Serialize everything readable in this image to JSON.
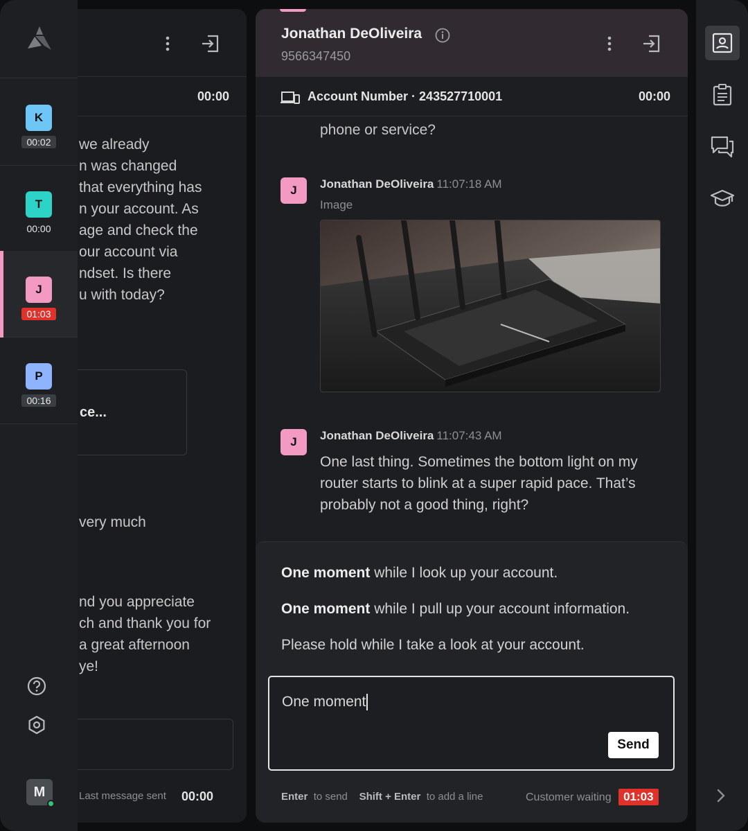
{
  "rail": {
    "conversations": [
      {
        "initial": "K",
        "time": "00:02",
        "color": "#6dc6f5",
        "time_bg": "#3a3d42",
        "active": false
      },
      {
        "initial": "T",
        "time": "00:00",
        "color": "#2ed3c8",
        "time_bg": "transparent",
        "active": false
      },
      {
        "initial": "J",
        "time": "01:03",
        "color": "#f29ac1",
        "time_bg": "#e0322b",
        "active": true
      },
      {
        "initial": "P",
        "time": "00:16",
        "color": "#8fb4ff",
        "time_bg": "#3a3d42",
        "active": false
      }
    ],
    "user_initial": "M"
  },
  "bg_panel": {
    "timer": "00:00",
    "lines": [
      "we already",
      "n was changed",
      "that everything has",
      "n your account. As",
      "age and check the",
      "our account via",
      "ndset. Is there",
      "u with today?",
      "very much",
      "nd you appreciate",
      "ch and thank you for",
      "a great afternoon",
      "ye!"
    ],
    "card_text": "ce...",
    "footer_label": "Last message sent",
    "footer_time": "00:00"
  },
  "chat": {
    "name": "Jonathan DeOliveira",
    "phone": "9566347450",
    "account_label": "Account Number",
    "account_sep": "·",
    "account_number": "243527710001",
    "timer": "00:00",
    "partial_text": "phone or service?",
    "messages": [
      {
        "initial": "J",
        "author": "Jonathan DeOliveira",
        "time": "11:07:18 AM",
        "kind": "Image"
      },
      {
        "initial": "J",
        "author": "Jonathan DeOliveira",
        "time": "11:07:43 AM",
        "text": "One last thing. Sometimes the bottom light on my router starts to blink at a super rapid pace. That’s probably not a good thing, right?"
      }
    ],
    "suggestions": [
      {
        "bold": "One moment",
        "rest": " while I look up your account."
      },
      {
        "bold": "One moment",
        "rest": " while I pull up your account information."
      },
      {
        "bold": "",
        "rest": "Please hold while I take a look at your account."
      }
    ],
    "composer_value": "One moment",
    "send_label": "Send",
    "hint_enter_key": "Enter",
    "hint_enter_text": "to send",
    "hint_shift_key": "Shift + Enter",
    "hint_shift_text": "to add a line",
    "waiting_label": "Customer waiting",
    "waiting_time": "01:03"
  },
  "right_rail": {
    "icons": [
      "contact-card-icon",
      "clipboard-icon",
      "chat-bubbles-icon",
      "graduation-cap-icon",
      "chevron-right-icon"
    ]
  },
  "colors": {
    "accent_pink": "#f29ac1",
    "alert_red": "#e0322b",
    "header_bg": "#312b31"
  }
}
